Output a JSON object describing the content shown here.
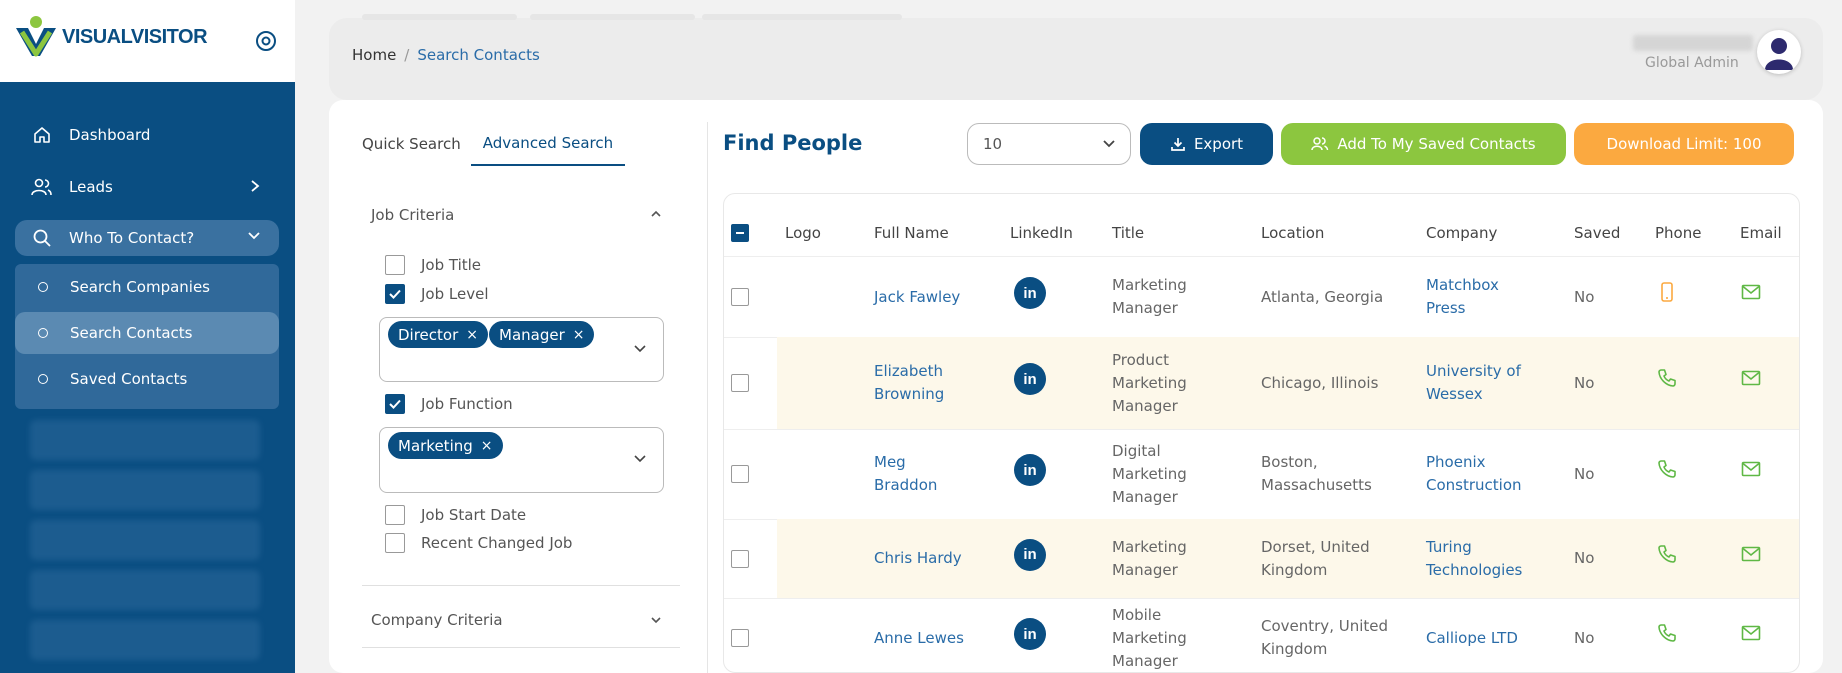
{
  "brand": {
    "logo_part1": "VISUAL",
    "logo_part2": "VISITOR"
  },
  "sidebar": {
    "items": [
      {
        "label": "Dashboard",
        "icon": "home-icon"
      },
      {
        "label": "Leads",
        "icon": "users-icon"
      },
      {
        "label": "Who To Contact?",
        "icon": "search-icon"
      }
    ],
    "submenu": [
      {
        "label": "Search Companies"
      },
      {
        "label": "Search Contacts"
      },
      {
        "label": "Saved Contacts"
      }
    ]
  },
  "header": {
    "breadcrumb": {
      "home": "Home",
      "separator": "/",
      "current": "Search Contacts"
    },
    "user_role": "Global Admin"
  },
  "search": {
    "tabs": [
      "Quick Search",
      "Advanced Search"
    ],
    "active_tab": "Advanced Search",
    "job_criteria": {
      "title": "Job Criteria",
      "options": {
        "job_title": {
          "label": "Job Title",
          "checked": false
        },
        "job_level": {
          "label": "Job Level",
          "checked": true
        },
        "job_function": {
          "label": "Job Function",
          "checked": true
        },
        "job_start_date": {
          "label": "Job Start Date",
          "checked": false
        },
        "recent_changed_job": {
          "label": "Recent Changed Job",
          "checked": false
        }
      },
      "job_level_tags": [
        "Director",
        "Manager"
      ],
      "job_function_tags": [
        "Marketing"
      ],
      "tag_remove_glyph": "×"
    },
    "company_criteria": {
      "title": "Company Criteria"
    }
  },
  "results": {
    "title": "Find People",
    "page_size": "10",
    "export_label": "Export",
    "add_saved_label": "Add To My Saved Contacts",
    "download_limit_label": "Download Limit: 100",
    "columns": [
      "Logo",
      "Full Name",
      "LinkedIn",
      "Title",
      "Location",
      "Company",
      "Saved",
      "Phone",
      "Email"
    ],
    "linkedin_glyph": "in",
    "rows": [
      {
        "name": [
          "Jack Fawley"
        ],
        "title": [
          "Marketing",
          "Manager"
        ],
        "location": [
          "Atlanta, Georgia"
        ],
        "company": [
          "Matchbox",
          "Press"
        ],
        "saved": "No",
        "phone": "mobile"
      },
      {
        "name": [
          "Elizabeth",
          "Browning"
        ],
        "title": [
          "Product",
          "Marketing",
          "Manager"
        ],
        "location": [
          "Chicago, Illinois"
        ],
        "company": [
          "University of",
          "Wessex"
        ],
        "saved": "No",
        "phone": "phone"
      },
      {
        "name": [
          "Meg",
          "Braddon"
        ],
        "title": [
          "Digital",
          "Marketing",
          "Manager"
        ],
        "location": [
          "Boston,",
          "Massachusetts"
        ],
        "company": [
          "Phoenix",
          "Construction"
        ],
        "saved": "No",
        "phone": "phone"
      },
      {
        "name": [
          "Chris Hardy"
        ],
        "title": [
          "Marketing",
          "Manager"
        ],
        "location": [
          "Dorset, United",
          "Kingdom"
        ],
        "company": [
          "Turing",
          "Technologies"
        ],
        "saved": "No",
        "phone": "phone"
      },
      {
        "name": [
          "Anne Lewes"
        ],
        "title": [
          "Mobile",
          "Marketing",
          "Manager"
        ],
        "location": [
          "Coventry, United",
          "Kingdom"
        ],
        "company": [
          "Calliope LTD"
        ],
        "saved": "No",
        "phone": "phone"
      }
    ]
  },
  "colors": {
    "primary": "#0a4e82",
    "green": "#8cc63f",
    "orange": "#fba940",
    "link": "#2a6ca8",
    "row_alt": "#fdf8ea"
  }
}
